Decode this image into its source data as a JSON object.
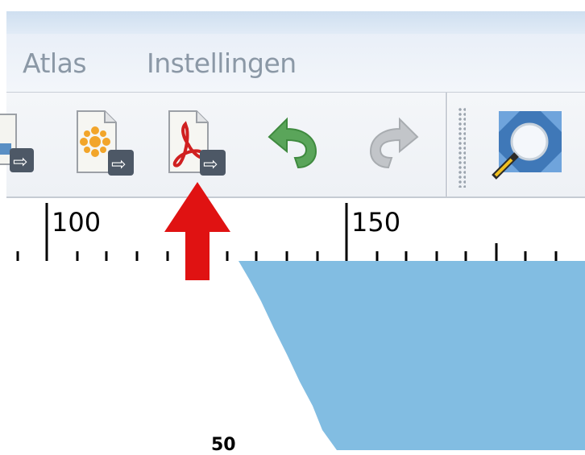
{
  "menu": {
    "items": [
      "Atlas",
      "Instellingen"
    ]
  },
  "toolbar": {
    "buttons": [
      {
        "name": "export-image-button",
        "icon": "export-image-icon"
      },
      {
        "name": "export-svg-button",
        "icon": "export-svg-icon"
      },
      {
        "name": "export-pdf-button",
        "icon": "pdf-export-icon"
      },
      {
        "name": "undo-button",
        "icon": "undo-arrow-icon",
        "color": "#5aa55a"
      },
      {
        "name": "redo-button",
        "icon": "redo-arrow-icon",
        "color": "#b8bcc0",
        "disabled": true
      },
      {
        "name": "zoom-full-button",
        "icon": "zoom-full-icon",
        "color": "#3f78b8"
      }
    ]
  },
  "ruler": {
    "labels": [
      "100",
      "150"
    ]
  },
  "canvas": {
    "label": "50",
    "map_fill": "#82bde2"
  },
  "annotation": {
    "icon": "red-arrow-up-icon",
    "color": "#e01212"
  }
}
